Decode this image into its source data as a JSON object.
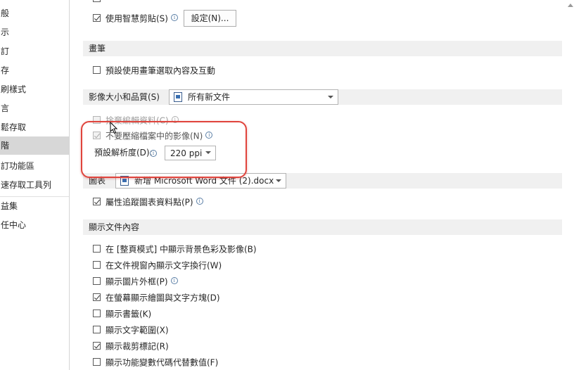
{
  "nav": {
    "items": [
      {
        "label": "般"
      },
      {
        "label": "示"
      },
      {
        "label": "訂"
      },
      {
        "label": "存"
      },
      {
        "label": "刷樣式"
      },
      {
        "label": "言"
      },
      {
        "label": "鬆存取"
      },
      {
        "label": "階",
        "selected": true
      },
      {
        "label": "訂功能區"
      },
      {
        "label": "速存取工具列"
      },
      {
        "label": "益集"
      },
      {
        "label": "任中心"
      }
    ]
  },
  "smart_cut": {
    "label": "使用智慧剪貼(S)",
    "checked": true,
    "settings_button": "設定(N)..."
  },
  "pen": {
    "header": "畫筆",
    "option": {
      "label": "預設使用畫筆選取內容及互動",
      "checked": false
    }
  },
  "image_quality": {
    "header": "影像大小和品質(S)",
    "doc_select": "所有新文件",
    "discard_edit": {
      "label": "捨棄編輯資料(C)",
      "checked": false,
      "disabled": true
    },
    "no_compress": {
      "label": "不要壓縮檔案中的影像(N)",
      "checked": true,
      "disabled": true
    },
    "resolution_label": "預設解析度(D):",
    "resolution_value": "220 ppi"
  },
  "chart": {
    "header": "圖表",
    "doc_select": "新增 Microsoft Word 文件 (2).docx",
    "property_tracking": {
      "label": "屬性追蹤圖表資料點(P)",
      "checked": true
    }
  },
  "display": {
    "header": "顯示文件內容",
    "options": [
      {
        "label": "在 [整頁模式] 中顯示背景色彩及影像(B)",
        "checked": false
      },
      {
        "label": "在文件視窗內顯示文字換行(W)",
        "checked": false
      },
      {
        "label": "顯示圖片外框(P)",
        "checked": false,
        "info": true
      },
      {
        "label": "在螢幕顯示繪圖與文字方塊(D)",
        "checked": true
      },
      {
        "label": "顯示書籤(K)",
        "checked": false
      },
      {
        "label": "顯示文字範圍(X)",
        "checked": false
      },
      {
        "label": "顯示裁剪標記(R)",
        "checked": true
      },
      {
        "label": "顯示功能變數代碼代替數值(F)",
        "checked": false
      }
    ]
  },
  "info_glyph": "i",
  "colors": {
    "annotation": "#e0443c",
    "section_bg": "#f0f0f0",
    "selected_nav": "#d7d7d7"
  }
}
